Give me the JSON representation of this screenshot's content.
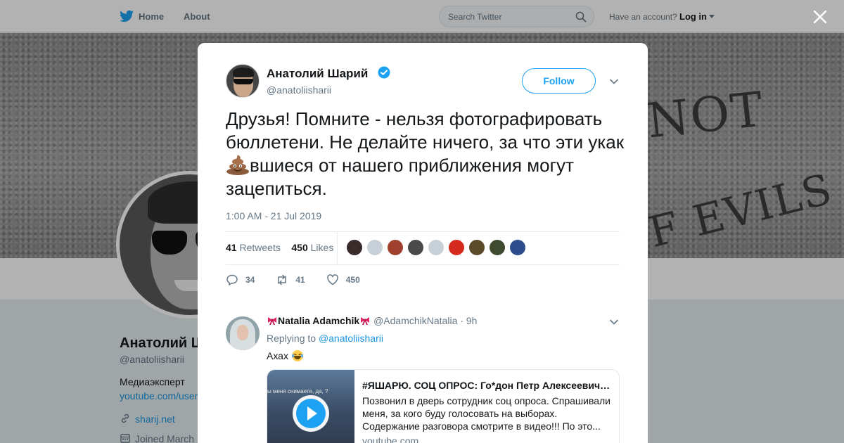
{
  "topbar": {
    "home_label": "Home",
    "about_label": "About",
    "search_placeholder": "Search Twitter",
    "account_text": "Have an account?",
    "login_label": "Log in"
  },
  "banner": {
    "line1": "NOT",
    "line2": "F EVILS"
  },
  "profile": {
    "name": "Анатолий Шарий",
    "handle": "@anatoliisharii",
    "bio": "Медиаэксперт",
    "url": "youtube.com/user",
    "site": "sharij.net",
    "joined": "Joined March"
  },
  "tweet": {
    "author_name": "Анатолий Шарий",
    "author_handle": "@anatoliisharii",
    "follow_label": "Follow",
    "text_before_emoji": "Друзья! Помните - нельзя фотографировать бюллетени. Не делайте ничего, за что эти укак",
    "text_after_emoji": "вшиеся от нашего приближения могут зацепиться.",
    "timestamp": "1:00 AM - 21 Jul 2019",
    "retweets_count": "41",
    "retweets_label": "Retweets",
    "likes_count": "450",
    "likes_label": "Likes",
    "likers": [
      "#3b2a2a",
      "#c7d0d8",
      "#a0412f",
      "#4a4a4a",
      "#c7d0d8",
      "#d52b1e",
      "#5b4b2b",
      "#3f4a2f",
      "#2d4a8a"
    ],
    "actions": {
      "replies": "34",
      "retweets": "41",
      "likes": "450"
    }
  },
  "reply": {
    "name": "Natalia Adamchik",
    "handle": "@AdamchikNatalia",
    "time": "· 9h",
    "replying_label": "Replying to",
    "replying_to": "@anatoliisharii",
    "text": "Ахах",
    "card": {
      "thumb_caption": "ы меня снимаете, да, ?",
      "title": "#ЯШАРЮ. СОЦ ОПРОС: Го*дон Петр Алексеевич…",
      "description": "Позвонил в дверь сотрудник соц опроса. Спрашивали меня, за кого буду голосовать на выборах. Содержание разговора смотрите в видео!!! По это...",
      "domain": "youtube.com"
    }
  },
  "colors": {
    "brand": "#1da1f2",
    "link": "#1b95e0",
    "secondary_text": "#657786"
  }
}
